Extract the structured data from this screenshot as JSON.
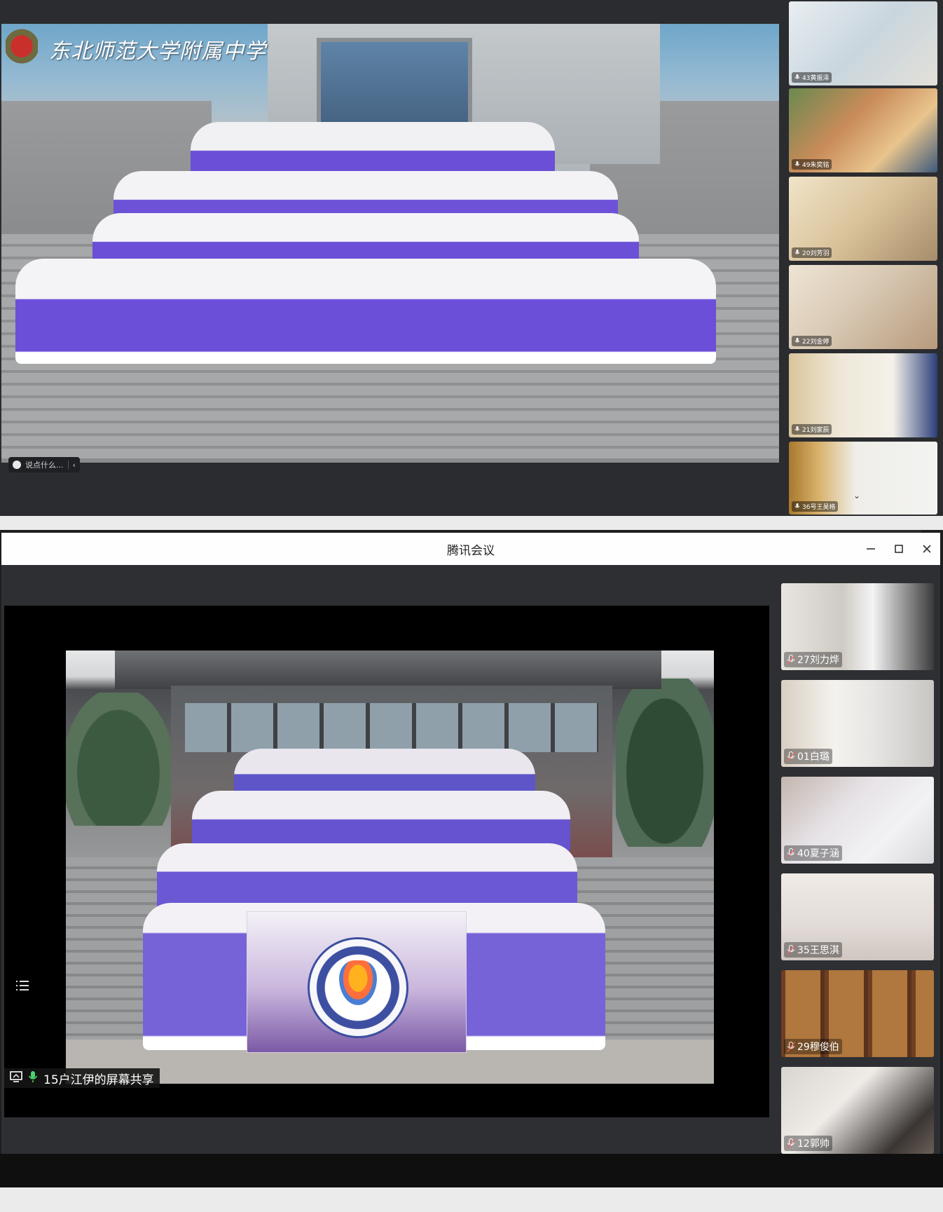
{
  "top_meeting": {
    "school_name": "东北师范大学附属中学",
    "chat_placeholder": "说点什么...",
    "participants": [
      {
        "name": "43黄振泽"
      },
      {
        "name": "49朱奕铭"
      },
      {
        "name": "20刘芳羽"
      },
      {
        "name": "22刘金婷"
      },
      {
        "name": "21刘家辰"
      },
      {
        "name": "36号王昊格"
      }
    ]
  },
  "bottom_meeting": {
    "app_title": "腾讯会议",
    "share_label": "15户江伊的屏幕共享",
    "participants": [
      {
        "name": "27刘力烨"
      },
      {
        "name": "01白璐"
      },
      {
        "name": "40夏子涵"
      },
      {
        "name": "35王思淇"
      },
      {
        "name": "29穆俊伯"
      },
      {
        "name": "12郭帅"
      }
    ]
  },
  "colors": {
    "uniform_purple": "#6b4fd6",
    "uniform_white": "#f4f4f6",
    "meeting_dark": "#2e2f32",
    "titlebar": "#fefefe"
  },
  "icons": [
    "mic-icon",
    "minimize-icon",
    "maximize-icon",
    "close-icon",
    "chevron-left-icon",
    "emoji-icon",
    "list-icon",
    "screen-share-icon",
    "chevron-down-icon"
  ]
}
